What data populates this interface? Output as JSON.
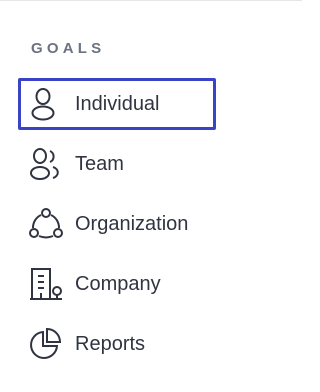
{
  "section": {
    "title": "GOALS"
  },
  "nav": {
    "items": [
      {
        "label": "Individual",
        "icon": "user-icon",
        "active": true
      },
      {
        "label": "Team",
        "icon": "users-icon",
        "active": false
      },
      {
        "label": "Organization",
        "icon": "organization-icon",
        "active": false
      },
      {
        "label": "Company",
        "icon": "building-icon",
        "active": false
      },
      {
        "label": "Reports",
        "icon": "pie-chart-icon",
        "active": false
      }
    ]
  },
  "colors": {
    "active_outline": "#3843c5",
    "heading": "#6b7280",
    "label": "#2f3440",
    "icon_stroke": "#2f3440"
  }
}
